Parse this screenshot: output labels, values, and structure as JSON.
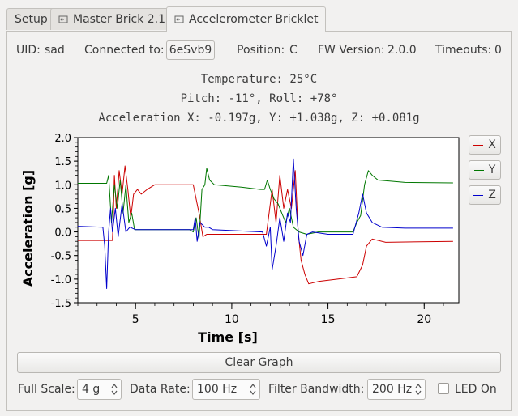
{
  "tabs": [
    {
      "label": "Setup"
    },
    {
      "label": "Master Brick 2.1"
    },
    {
      "label": "Accelerometer Bricklet"
    }
  ],
  "info": {
    "uid_label": "UID:",
    "uid_value": "sad",
    "connected_label": "Connected to:",
    "connected_value": "6eSvb9",
    "position_label": "Position:",
    "position_value": "C",
    "fw_label": "FW Version:",
    "fw_value": "2.0.0",
    "timeouts_label": "Timeouts:",
    "timeouts_value": "0"
  },
  "readouts": {
    "temperature": "Temperature: 25°C",
    "pitch_roll": "Pitch: -11°, Roll: +78°",
    "acceleration": "Acceleration X: -0.197g, Y: +1.038g, Z: +0.081g"
  },
  "legend": [
    {
      "label": "X",
      "color": "#cc0000"
    },
    {
      "label": "Y",
      "color": "#007700"
    },
    {
      "label": "Z",
      "color": "#0000cc"
    }
  ],
  "chart_data": {
    "type": "line",
    "xlabel": "Time [s]",
    "ylabel": "Acceleration [g]",
    "xlim": [
      2,
      21.8
    ],
    "ylim": [
      -1.5,
      2.0
    ],
    "xticks": [
      5,
      10,
      15,
      20
    ],
    "yticks": [
      -1.5,
      -1.0,
      -0.5,
      0.0,
      0.5,
      1.0,
      1.5,
      2.0
    ],
    "ytick_labels": [
      "-1.5",
      "-1.0",
      "-0.5",
      "0.0",
      "0.5",
      "1.0",
      "1.5",
      "2.0"
    ],
    "series": [
      {
        "name": "X",
        "color": "#cc0000",
        "points": [
          [
            2.0,
            -0.18
          ],
          [
            3.8,
            -0.18
          ],
          [
            3.85,
            0.4
          ],
          [
            3.9,
            1.2
          ],
          [
            4.0,
            0.5
          ],
          [
            4.15,
            1.3
          ],
          [
            4.3,
            0.8
          ],
          [
            4.45,
            1.4
          ],
          [
            4.6,
            0.9
          ],
          [
            4.75,
            0.3
          ],
          [
            4.9,
            0.8
          ],
          [
            5.1,
            0.9
          ],
          [
            5.3,
            0.8
          ],
          [
            5.6,
            0.9
          ],
          [
            6.0,
            1.0
          ],
          [
            8.0,
            1.0
          ],
          [
            8.3,
            0.4
          ],
          [
            8.5,
            -0.1
          ],
          [
            8.7,
            -0.05
          ],
          [
            10.0,
            -0.05
          ],
          [
            11.8,
            -0.05
          ],
          [
            12.1,
            0.9
          ],
          [
            12.3,
            0.2
          ],
          [
            12.5,
            1.2
          ],
          [
            12.7,
            0.5
          ],
          [
            12.9,
            0.9
          ],
          [
            13.1,
            0.5
          ],
          [
            13.3,
            1.3
          ],
          [
            13.45,
            0.0
          ],
          [
            13.6,
            -0.6
          ],
          [
            13.8,
            -0.9
          ],
          [
            14.0,
            -1.1
          ],
          [
            14.5,
            -1.05
          ],
          [
            15.5,
            -1.0
          ],
          [
            16.5,
            -0.95
          ],
          [
            16.8,
            -0.7
          ],
          [
            17.0,
            -0.3
          ],
          [
            17.3,
            -0.15
          ],
          [
            18.0,
            -0.22
          ],
          [
            21.5,
            -0.2
          ]
        ]
      },
      {
        "name": "Y",
        "color": "#007700",
        "points": [
          [
            2.0,
            1.03
          ],
          [
            3.5,
            1.03
          ],
          [
            3.6,
            1.2
          ],
          [
            3.75,
            0.2
          ],
          [
            3.9,
            1.0
          ],
          [
            4.05,
            0.5
          ],
          [
            4.2,
            1.1
          ],
          [
            4.35,
            0.4
          ],
          [
            4.5,
            1.0
          ],
          [
            4.65,
            0.2
          ],
          [
            4.8,
            0.4
          ],
          [
            4.95,
            0.05
          ],
          [
            5.2,
            0.05
          ],
          [
            6.0,
            0.05
          ],
          [
            7.8,
            0.05
          ],
          [
            8.0,
            0.0
          ],
          [
            8.15,
            0.3
          ],
          [
            8.3,
            -0.15
          ],
          [
            8.45,
            0.9
          ],
          [
            8.6,
            1.0
          ],
          [
            8.7,
            1.35
          ],
          [
            8.85,
            1.1
          ],
          [
            9.1,
            1.0
          ],
          [
            10.5,
            0.95
          ],
          [
            11.5,
            0.9
          ],
          [
            11.7,
            0.9
          ],
          [
            11.85,
            1.1
          ],
          [
            12.0,
            0.9
          ],
          [
            12.2,
            0.7
          ],
          [
            12.4,
            0.6
          ],
          [
            12.6,
            0.4
          ],
          [
            12.8,
            0.2
          ],
          [
            13.0,
            0.5
          ],
          [
            13.2,
            0.1
          ],
          [
            13.5,
            0.0
          ],
          [
            13.9,
            -0.05
          ],
          [
            14.5,
            0.0
          ],
          [
            15.5,
            0.0
          ],
          [
            16.3,
            0.0
          ],
          [
            16.5,
            0.2
          ],
          [
            16.7,
            0.35
          ],
          [
            16.9,
            1.0
          ],
          [
            17.1,
            1.3
          ],
          [
            17.3,
            1.2
          ],
          [
            17.6,
            1.1
          ],
          [
            19.0,
            1.05
          ],
          [
            21.5,
            1.04
          ]
        ]
      },
      {
        "name": "Z",
        "color": "#0000cc",
        "points": [
          [
            2.0,
            0.12
          ],
          [
            3.3,
            0.1
          ],
          [
            3.4,
            -0.3
          ],
          [
            3.5,
            -1.2
          ],
          [
            3.6,
            0.0
          ],
          [
            3.7,
            0.5
          ],
          [
            3.8,
            0.0
          ],
          [
            3.95,
            0.5
          ],
          [
            4.1,
            -0.1
          ],
          [
            4.3,
            0.6
          ],
          [
            4.5,
            0.0
          ],
          [
            4.7,
            0.1
          ],
          [
            5.0,
            0.05
          ],
          [
            6.0,
            0.05
          ],
          [
            8.0,
            0.05
          ],
          [
            8.1,
            0.3
          ],
          [
            8.2,
            -0.2
          ],
          [
            8.35,
            0.2
          ],
          [
            8.6,
            0.1
          ],
          [
            8.8,
            0.1
          ],
          [
            9.0,
            0.05
          ],
          [
            11.6,
            0.0
          ],
          [
            11.8,
            -0.3
          ],
          [
            12.0,
            0.1
          ],
          [
            12.1,
            -0.8
          ],
          [
            12.3,
            -0.3
          ],
          [
            12.5,
            0.3
          ],
          [
            12.7,
            -0.2
          ],
          [
            12.9,
            0.4
          ],
          [
            13.05,
            0.2
          ],
          [
            13.2,
            1.55
          ],
          [
            13.35,
            0.5
          ],
          [
            13.5,
            -0.2
          ],
          [
            13.7,
            -0.5
          ],
          [
            13.9,
            -0.05
          ],
          [
            14.2,
            0.0
          ],
          [
            15.0,
            -0.05
          ],
          [
            16.0,
            -0.05
          ],
          [
            16.3,
            -0.05
          ],
          [
            16.6,
            0.4
          ],
          [
            16.8,
            0.8
          ],
          [
            17.0,
            0.4
          ],
          [
            17.3,
            0.2
          ],
          [
            17.8,
            0.1
          ],
          [
            19.0,
            0.08
          ],
          [
            21.5,
            0.08
          ]
        ]
      }
    ]
  },
  "buttons": {
    "clear_graph": "Clear Graph"
  },
  "controls": {
    "full_scale_label": "Full Scale:",
    "full_scale_value": "4 g",
    "data_rate_label": "Data Rate:",
    "data_rate_value": "100 Hz",
    "filter_label": "Filter Bandwidth:",
    "filter_value": "200 Hz",
    "led_label": "LED On",
    "led_checked": false
  }
}
